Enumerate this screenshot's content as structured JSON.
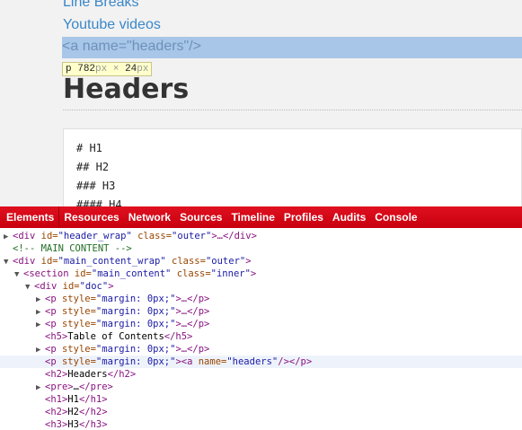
{
  "page": {
    "links": {
      "line_breaks": "Line Breaks",
      "youtube_videos": "Youtube videos"
    },
    "highlighted_source": "<a name=\"headers\"/>",
    "tooltip": {
      "tag": "p",
      "width_value": "782",
      "height_value": "24",
      "unit": "px",
      "times": "×"
    },
    "heading": "Headers",
    "code_lines": [
      "# H1",
      "## H2",
      "### H3",
      "#### H4"
    ],
    "colors": {
      "link": "#3a87c8",
      "highlight": "#a8c6e8",
      "toolbar": "#d4000f"
    }
  },
  "devtools": {
    "tabs": [
      "Elements",
      "Resources",
      "Network",
      "Sources",
      "Timeline",
      "Profiles",
      "Audits",
      "Console"
    ],
    "active_tab": "Elements",
    "tree": {
      "r0": {
        "open": "<div",
        "a1n": " id=",
        "a1v": "\"header_wrap\"",
        "a2n": " class=",
        "a2v": "\"outer\"",
        "close": ">…</div>"
      },
      "r1": {
        "comment": "<!-- MAIN CONTENT -->"
      },
      "r2": {
        "open": "<div",
        "a1n": " id=",
        "a1v": "\"main_content_wrap\"",
        "a2n": " class=",
        "a2v": "\"outer\"",
        "close": ">"
      },
      "r3": {
        "open": "<section",
        "a1n": " id=",
        "a1v": "\"main_content\"",
        "a2n": " class=",
        "a2v": "\"inner\"",
        "close": ">"
      },
      "r4": {
        "open": "<div",
        "a1n": " id=",
        "a1v": "\"doc\"",
        "close": ">"
      },
      "r5": {
        "open": "<p",
        "a1n": " style=",
        "a1v": "\"margin: 0px;\"",
        "close": ">…</p>"
      },
      "r6": {
        "open": "<p",
        "a1n": " style=",
        "a1v": "\"margin: 0px;\"",
        "close": ">…</p>"
      },
      "r7": {
        "open": "<p",
        "a1n": " style=",
        "a1v": "\"margin: 0px;\"",
        "close": ">…</p>"
      },
      "r8": {
        "open": "<h5>",
        "text": "Table of Contents",
        "close": "</h5>"
      },
      "r9": {
        "open": "<p",
        "a1n": " style=",
        "a1v": "\"margin: 0px;\"",
        "close": ">…</p>"
      },
      "r10": {
        "open": "<p",
        "a1n": " style=",
        "a1v": "\"margin: 0px;\"",
        "mid": "><a",
        "a2n": " name=",
        "a2v": "\"headers\"",
        "close": "/></p>"
      },
      "r11": {
        "open": "<h2>",
        "text": "Headers",
        "close": "</h2>"
      },
      "r12": {
        "open": "<pre>",
        "text": "…",
        "close": "</pre>"
      },
      "r13": {
        "open": "<h1>",
        "text": "H1",
        "close": "</h1>"
      },
      "r14": {
        "open": "<h2>",
        "text": "H2",
        "close": "</h2>"
      },
      "r15": {
        "open": "<h3>",
        "text": "H3",
        "close": "</h3>"
      }
    }
  }
}
